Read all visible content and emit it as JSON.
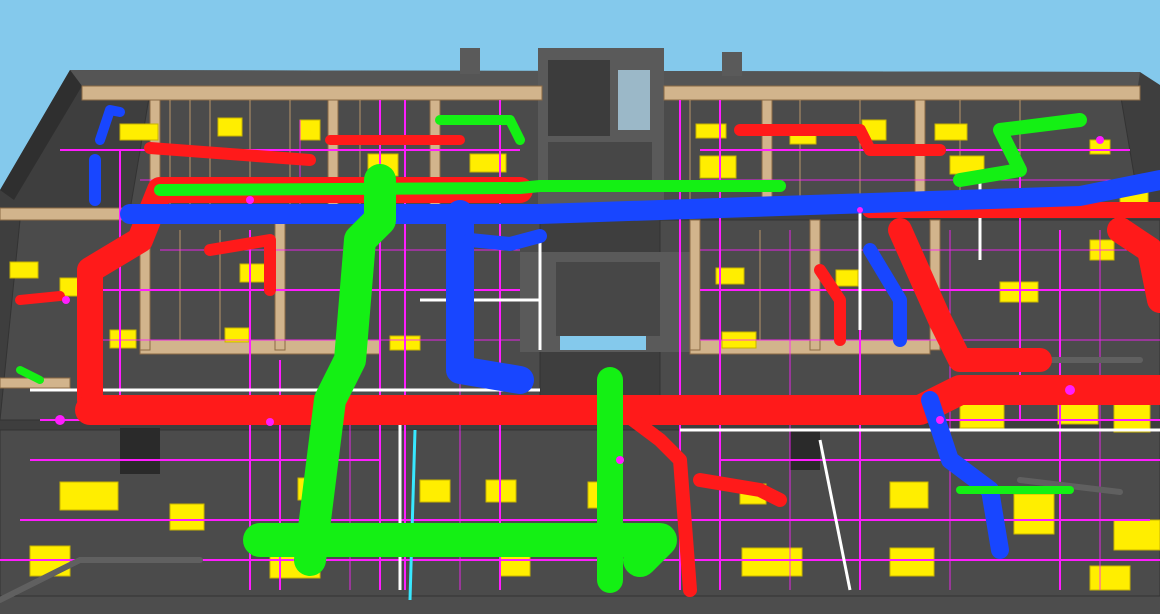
{
  "view": {
    "kind": "3d-bim-mep-coordination-model",
    "projection": "perspective-aerial",
    "colors": {
      "sky": "#84c9ec",
      "slab_dark": "#3e3e3e",
      "slab_mid": "#5a5a5a",
      "floor_panel": "#4a4a4a",
      "wall_timber": "#d2b48c",
      "wall_timber_dark": "#b8956a",
      "duct_red": "#ff1a1a",
      "duct_blue": "#1846ff",
      "duct_green": "#14f014",
      "pipe_magenta": "#ff1dff",
      "equipment_yellow": "#ffee00",
      "pipe_white": "#ffffff",
      "pipe_cyan": "#38e8ff",
      "pipe_dark_gray": "#606060"
    },
    "systems": [
      {
        "name": "supply-duct",
        "color": "#ff1a1a"
      },
      {
        "name": "return-duct",
        "color": "#1846ff"
      },
      {
        "name": "exhaust-duct",
        "color": "#14f014"
      },
      {
        "name": "piping",
        "color": "#ff1dff"
      },
      {
        "name": "terminal-units",
        "color": "#ffee00"
      }
    ]
  }
}
